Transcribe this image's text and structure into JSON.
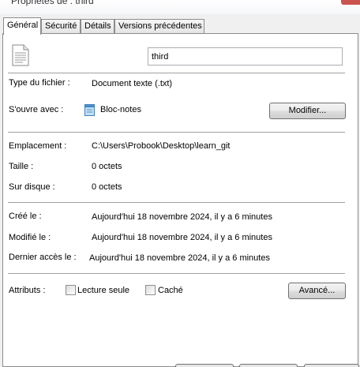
{
  "window": {
    "title": "Propriétés de : third"
  },
  "tabs": [
    "Général",
    "Sécurité",
    "Détails",
    "Versions précédentes"
  ],
  "general": {
    "file_name": "third",
    "file_type_label": "Type du fichier :",
    "file_type_value": "Document texte (.txt)",
    "opens_with_label": "S'ouvre avec :",
    "opens_with_value": "Bloc-notes",
    "change_button": "Modifier...",
    "location_label": "Emplacement :",
    "location_value": "C:\\Users\\Probook\\Desktop\\learn_git",
    "size_label": "Taille :",
    "size_value": "0 octets",
    "size_on_disk_label": "Sur disque :",
    "size_on_disk_value": "0 octets",
    "created_label": "Créé le :",
    "created_value": "Aujourd'hui 18 novembre 2024, il y a 6 minutes",
    "modified_label": "Modifié le :",
    "modified_value": "Aujourd'hui 18 novembre 2024, il y a 6 minutes",
    "accessed_label": "Dernier accès le :",
    "accessed_value": "Aujourd'hui 18 novembre 2024, il y a 6 minutes",
    "attributes_label": "Attributs :",
    "readonly_label": "Lecture seule",
    "hidden_label": "Caché",
    "advanced_button": "Avancé..."
  }
}
